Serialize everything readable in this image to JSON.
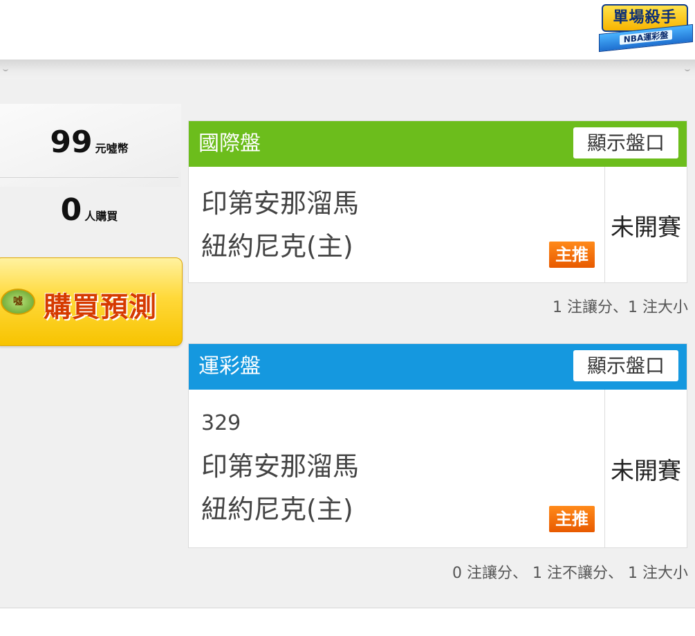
{
  "badge": {
    "title": "單場殺手",
    "subtitle": "NBA運彩盤"
  },
  "stats": {
    "price_value": "99",
    "price_unit": "元噓幣",
    "buyers_value": "0",
    "buyers_unit": "人購買"
  },
  "buy_button": {
    "coin_label": "噓",
    "label": "購買預測"
  },
  "cards": [
    {
      "title": "國際盤",
      "toggle_label": "顯示盤口",
      "game_id": "",
      "away_team": "印第安那溜馬",
      "home_team": "紐約尼克(主)",
      "tag": "主推",
      "status": "未開賽",
      "summary": "1 注讓分、1 注大小",
      "color": "#6cbd1c"
    },
    {
      "title": "運彩盤",
      "toggle_label": "顯示盤口",
      "game_id": "329",
      "away_team": "印第安那溜馬",
      "home_team": "紐約尼克(主)",
      "tag": "主推",
      "status": "未開賽",
      "summary": "0 注讓分、 1 注不讓分、 1 注大小",
      "color": "#1598df"
    }
  ]
}
